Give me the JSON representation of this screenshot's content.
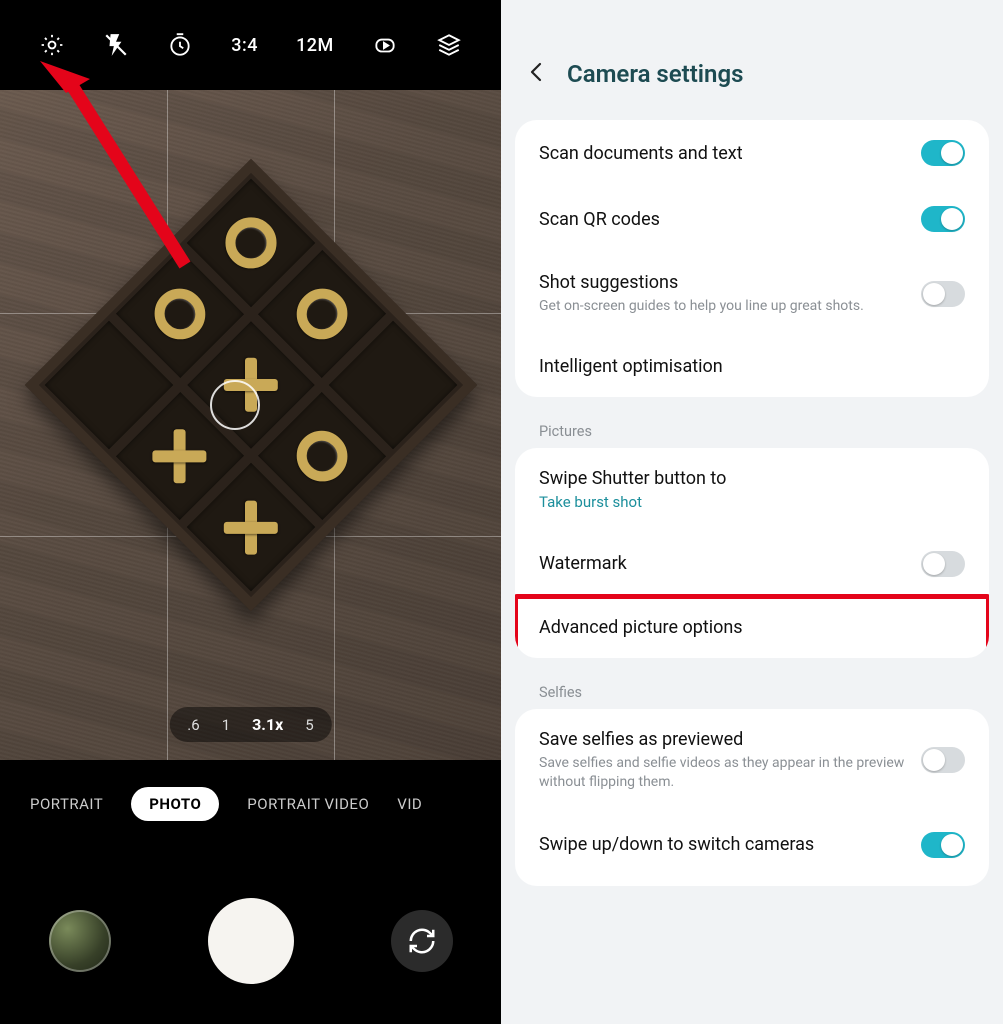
{
  "camera": {
    "topbar": {
      "settings_icon": "gear-icon",
      "flash_icon": "flash-off-icon",
      "timer_icon": "timer-icon",
      "aspect_ratio": "3:4",
      "resolution": "12M",
      "motion_icon": "motion-photo-icon",
      "filters_icon": "filters-icon"
    },
    "zoom": {
      "options": [
        ".6",
        "1",
        "3.1x",
        "5"
      ],
      "active_index": 2
    },
    "modes": {
      "items": [
        "PORTRAIT",
        "PHOTO",
        "PORTRAIT VIDEO",
        "VIDEO"
      ],
      "active_index": 1,
      "truncated_last": "VID"
    }
  },
  "settings": {
    "title": "Camera settings",
    "group_main": [
      {
        "title": "Scan documents and text",
        "toggle": "on"
      },
      {
        "title": "Scan QR codes",
        "toggle": "on"
      },
      {
        "title": "Shot suggestions",
        "subtitle": "Get on-screen guides to help you line up great shots.",
        "toggle": "off"
      },
      {
        "title": "Intelligent optimisation"
      }
    ],
    "section_pictures_label": "Pictures",
    "group_pictures": [
      {
        "title": "Swipe Shutter button to",
        "value": "Take burst shot"
      },
      {
        "title": "Watermark",
        "toggle": "off"
      },
      {
        "title": "Advanced picture options",
        "highlighted": true
      }
    ],
    "section_selfies_label": "Selfies",
    "group_selfies": [
      {
        "title": "Save selfies as previewed",
        "subtitle": "Save selfies and selfie videos as they appear in the preview without flipping them.",
        "toggle": "off"
      },
      {
        "title": "Swipe up/down to switch cameras",
        "toggle": "on"
      }
    ]
  }
}
